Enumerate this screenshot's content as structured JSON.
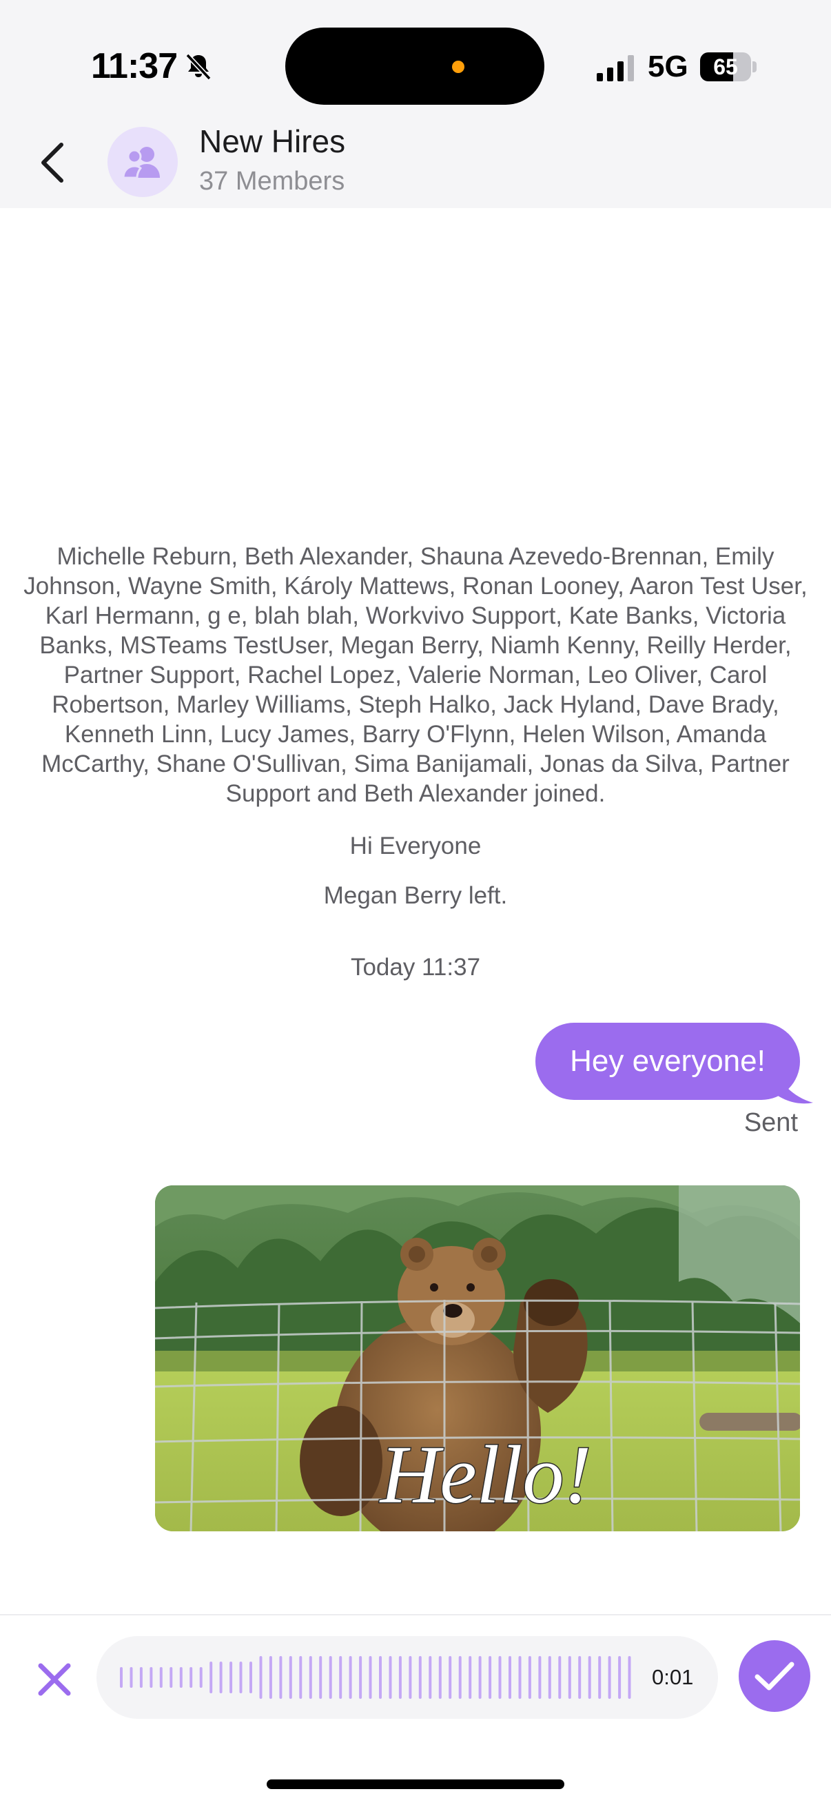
{
  "status_bar": {
    "time": "11:37",
    "network": "5G",
    "battery_level": "65",
    "battery_fraction": 0.65,
    "icons": [
      "bell-slash-icon",
      "signal-icon",
      "battery-icon"
    ]
  },
  "header": {
    "title": "New Hires",
    "subtitle": "37 Members",
    "icons": [
      "chevron-left-icon",
      "group-icon"
    ]
  },
  "chat": {
    "joined_notice": "Michelle Reburn, Beth Alexander, Shauna Azevedo-Brennan, Emily Johnson, Wayne Smith, Károly Mattews, Ronan Looney, Aaron Test User, Karl Hermann, g e, blah blah, Workvivo Support, Kate Banks, Victoria Banks, MSTeams TestUser, Megan Berry, Niamh Kenny, Reilly Herder, Partner Support, Rachel Lopez, Valerie Norman, Leo Oliver, Carol Robertson, Marley Williams, Steph Halko, Jack Hyland, Dave Brady, Kenneth Linn, Lucy James, Barry O'Flynn, Helen Wilson, Amanda McCarthy, Shane O'Sullivan, Sima Banijamali, Jonas da Silva, Partner Support and Beth Alexander joined.",
    "greeting": "Hi Everyone",
    "left_notice": "Megan Berry left.",
    "timestamp": "Today 11:37",
    "outgoing_message": "Hey everyone!",
    "delivery_status": "Sent",
    "gif": {
      "caption": "Hello!",
      "subject": "bear waving behind fence"
    }
  },
  "composer": {
    "recording_duration": "0:01",
    "icons": [
      "close-icon",
      "waveform-icon",
      "checkmark-icon"
    ]
  },
  "colors": {
    "accent": "#9b6cee",
    "accent_light": "#c4a8f5",
    "avatar_bg": "#e8e0fb",
    "header_bg": "#f5f5f7",
    "system_text": "#5e5e63"
  }
}
